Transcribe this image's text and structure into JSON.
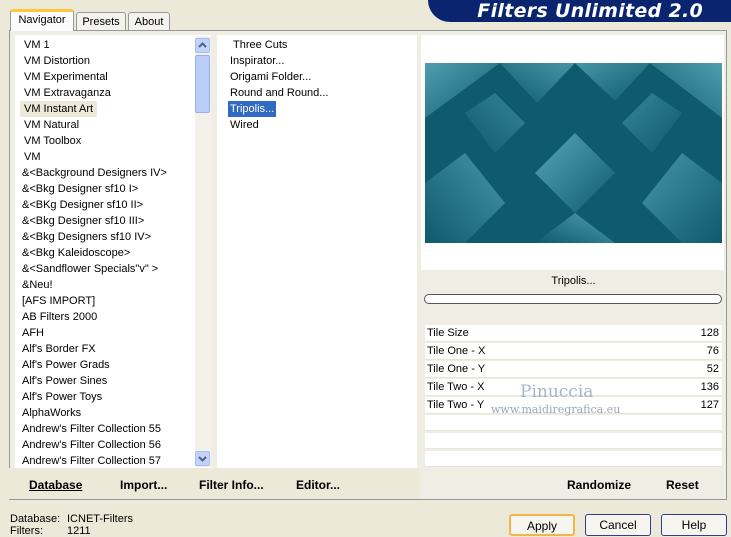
{
  "tabs": [
    {
      "label": "Navigator",
      "active": true
    },
    {
      "label": "Presets",
      "active": false
    },
    {
      "label": "About",
      "active": false
    }
  ],
  "banner": {
    "title": "Filters Unlimited 2.0"
  },
  "categories": [
    "VM 1",
    "VM Distortion",
    "VM Experimental",
    "VM Extravaganza",
    "VM Instant Art",
    "VM Natural",
    "VM Toolbox",
    "VM",
    "&<Background Designers IV>",
    "&<Bkg Designer sf10 I>",
    "&<BKg Designer sf10 II>",
    "&<Bkg Designer sf10 III>",
    "&<Bkg Designers sf10 IV>",
    "&<Bkg Kaleidoscope>",
    "&<Sandflower Specials\"v\" >",
    "&Neu!",
    "[AFS IMPORT]",
    "AB Filters 2000",
    "AFH",
    "Alf's Border FX",
    "Alf's Power Grads",
    "Alf's Power Sines",
    "Alf's Power Toys",
    "AlphaWorks",
    "Andrew's Filter Collection 55",
    "Andrew's Filter Collection 56",
    "Andrew's Filter Collection 57"
  ],
  "selected_category": "VM Instant Art",
  "filters": [
    "Three Cuts",
    "Inspirator...",
    "Origami Folder...",
    "Round and Round...",
    "Tripolis...",
    "Wired"
  ],
  "selected_filter": "Tripolis...",
  "preview": {
    "filter_name": "Tripolis...",
    "colors": {
      "dark": "#0F5A6C",
      "light": "#5FB0C2"
    }
  },
  "params": [
    {
      "label": "Tile Size",
      "value": "128"
    },
    {
      "label": "Tile One - X",
      "value": "76"
    },
    {
      "label": "Tile One - Y",
      "value": "52"
    },
    {
      "label": "Tile Two - X",
      "value": "136"
    },
    {
      "label": "Tile Two - Y",
      "value": "127"
    }
  ],
  "watermark": {
    "name": "Pinuccia",
    "url": "www.maidiregrafica.eu"
  },
  "commands": {
    "database": "Database",
    "import": "Import...",
    "filter_info": "Filter Info...",
    "editor": "Editor...",
    "randomize": "Randomize",
    "reset": "Reset"
  },
  "status": {
    "database_label": "Database:",
    "database_value": "ICNET-Filters",
    "filters_label": "Filters:",
    "filters_value": "1211"
  },
  "buttons": {
    "apply": "Apply",
    "cancel": "Cancel",
    "help": "Help"
  },
  "icons": {
    "scroll_up": "chevron-up-icon",
    "scroll_down": "chevron-down-icon"
  }
}
